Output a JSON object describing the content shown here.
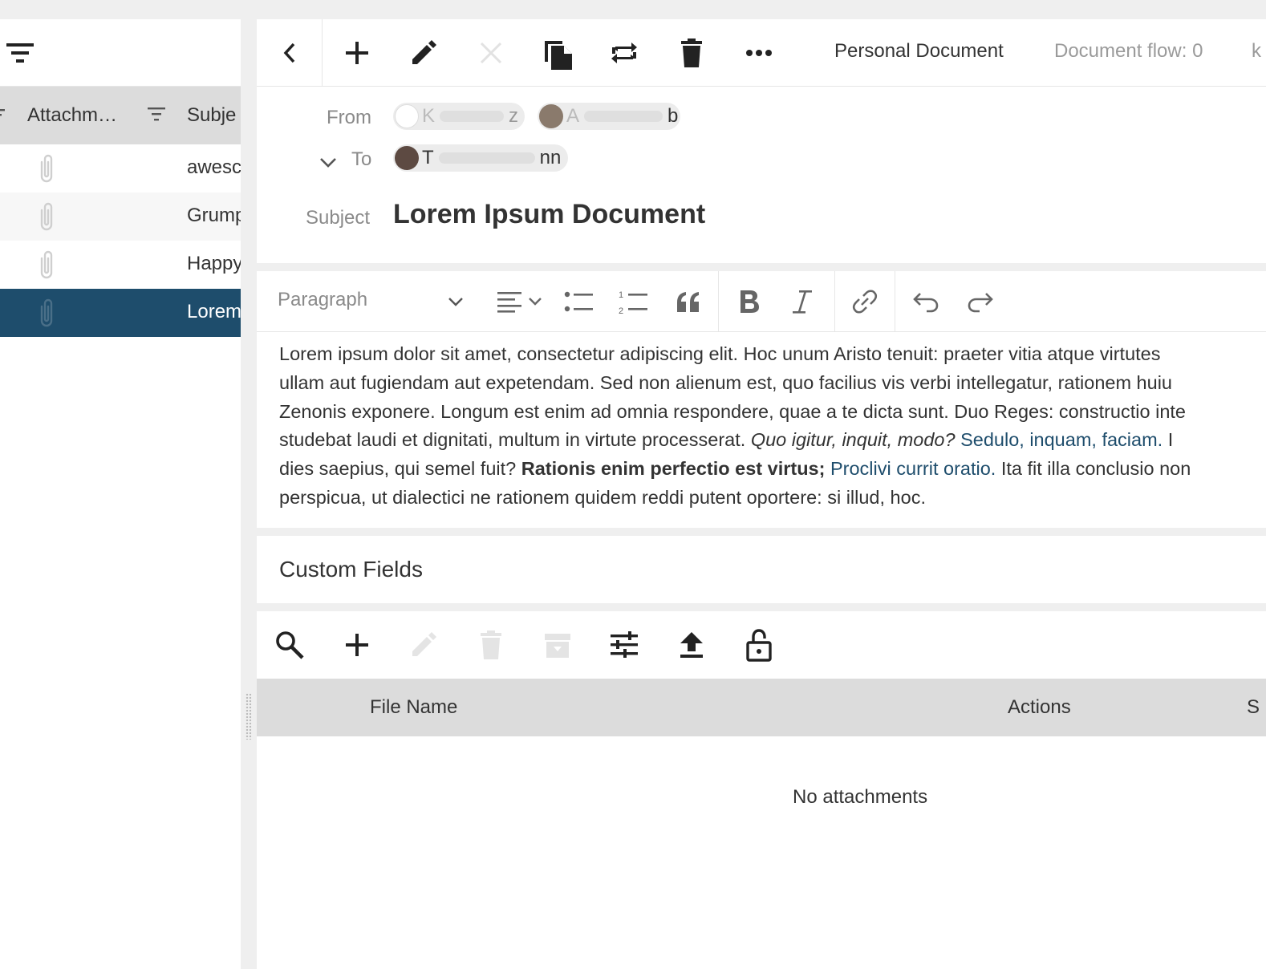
{
  "list": {
    "columns": {
      "attachments": "Attachm…",
      "subject": "Subje"
    },
    "rows": [
      {
        "subject": "awesc",
        "selected": false
      },
      {
        "subject": "Grump",
        "selected": false
      },
      {
        "subject": "Happy",
        "selected": false
      },
      {
        "subject": "Lorem",
        "selected": true
      }
    ]
  },
  "document": {
    "title": "Personal Document",
    "flow": "Document flow: 0",
    "flow_cut": "k",
    "from_label": "From",
    "to_label": "To",
    "subject_label": "Subject",
    "from": [
      {
        "visible_start": "K",
        "visible_end": "z"
      },
      {
        "visible_start": "A",
        "visible_end": "b"
      }
    ],
    "to": [
      {
        "visible_start": "T",
        "visible_end": "nn"
      }
    ],
    "subject": "Lorem Ipsum Document"
  },
  "editor": {
    "paragraph_style": "Paragraph",
    "lines": {
      "l1": "Lorem ipsum dolor sit amet, consectetur adipiscing elit. Hoc unum Aristo tenuit: praeter vitia atque virtutes",
      "l2": "ullam aut fugiendam aut expetendam. Sed non alienum est, quo facilius vis verbi intellegatur, rationem huiu",
      "l3": "Zenonis exponere. Longum est enim ad omnia respondere, quae a te dicta sunt. Duo Reges: constructio inte",
      "l4_a": "studebat laudi et dignitati, multum in virtute processerat. ",
      "l4_italic": "Quo igitur, inquit, modo?",
      "l4_link": "Sedulo, inquam, faciam.",
      "l4_b": " I",
      "l5_a": "dies saepius, qui semel fuit? ",
      "l5_bold": "Rationis enim perfectio est virtus;",
      "l5_link": "Proclivi currit oratio.",
      "l5_b": " Ita fit illa conclusio non",
      "l6": "perspicua, ut dialectici ne rationem quidem reddi putent oportere: si illud, hoc."
    }
  },
  "custom_fields": {
    "title": "Custom Fields"
  },
  "attachments": {
    "columns": {
      "file_name": "File Name",
      "actions": "Actions",
      "size_cut": "S"
    },
    "empty_text": "No attachments"
  },
  "colors": {
    "selected_row": "#1e4d6c",
    "link": "#1e4d6c",
    "header_bg": "#dcdcdc"
  }
}
